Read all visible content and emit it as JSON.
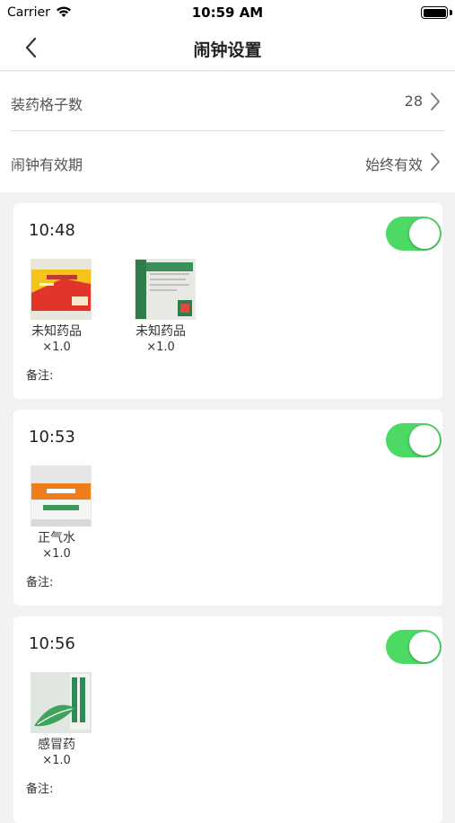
{
  "status": {
    "carrier": "Carrier",
    "time": "10:59 AM"
  },
  "nav": {
    "title": "闹钟设置"
  },
  "settings": [
    {
      "label": "装药格子数",
      "value": "28"
    },
    {
      "label": "闹钟有效期",
      "value": "始终有效"
    }
  ],
  "alarms": [
    {
      "time": "10:48",
      "enabled": true,
      "meds": [
        {
          "name": "未知药品",
          "qty": "×1.0",
          "icon": "medicine-box-yellow-red"
        },
        {
          "name": "未知药品",
          "qty": "×1.0",
          "icon": "medicine-box-green-white"
        }
      ],
      "note_label": "备注:"
    },
    {
      "time": "10:53",
      "enabled": true,
      "meds": [
        {
          "name": "正气水",
          "qty": "×1.0",
          "icon": "medicine-box-orange-white"
        }
      ],
      "note_label": "备注:"
    },
    {
      "time": "10:56",
      "enabled": true,
      "meds": [
        {
          "name": "感冒药",
          "qty": "×1.0",
          "icon": "medicine-box-green-leaf"
        }
      ],
      "note_label": "备注:"
    }
  ],
  "colors": {
    "toggle_on": "#4cd964",
    "background": "#f2f2f4"
  }
}
